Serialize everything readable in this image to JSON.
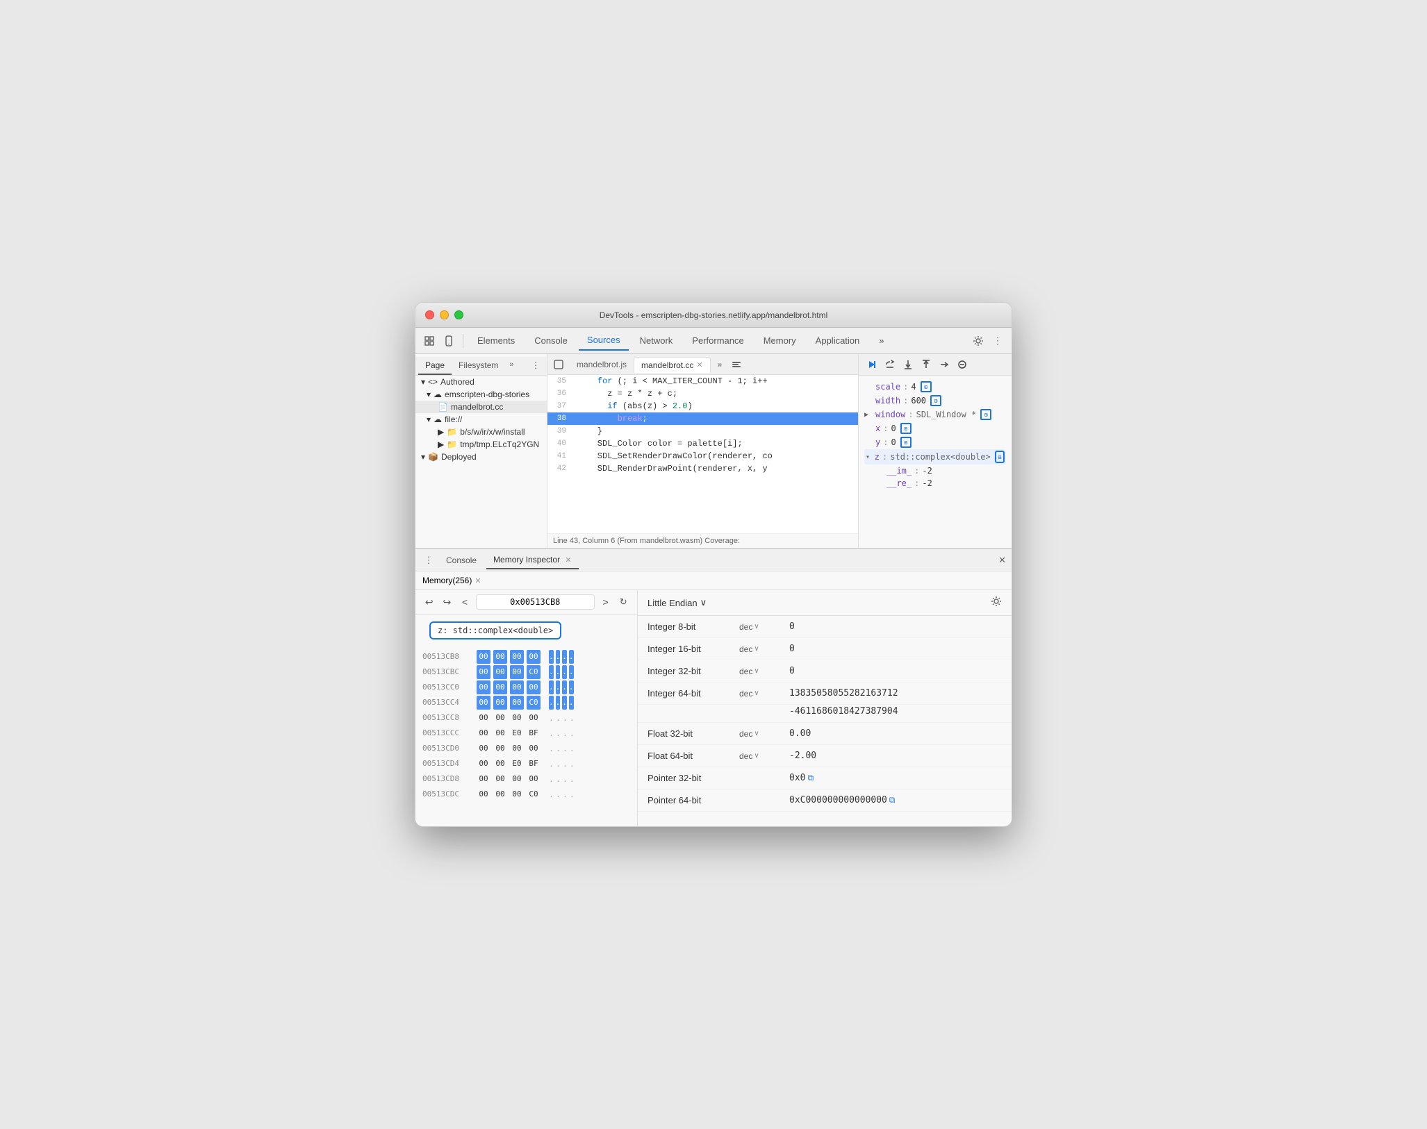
{
  "window": {
    "title": "DevTools - emscripten-dbg-stories.netlify.app/mandelbrot.html"
  },
  "toolbar": {
    "tabs": [
      {
        "label": "Elements",
        "active": false
      },
      {
        "label": "Console",
        "active": false
      },
      {
        "label": "Sources",
        "active": true
      },
      {
        "label": "Network",
        "active": false
      },
      {
        "label": "Performance",
        "active": false
      },
      {
        "label": "Memory",
        "active": false
      },
      {
        "label": "Application",
        "active": false
      }
    ]
  },
  "sources_panel": {
    "left_tabs": [
      {
        "label": "Page",
        "active": true
      },
      {
        "label": "Filesystem",
        "active": false
      }
    ],
    "tree": {
      "authored_label": "▾ <> Authored",
      "emscripten_label": "▾ ☁ emscripten-dbg-stories",
      "mandelbrot_cc": "mandelbrot.cc",
      "file_label": "▾ ☁ file://",
      "bswir_label": "▶ 📁 b/s/w/ir/x/w/install",
      "tmp_label": "▶ 📁 tmp/tmp.ELcTq2YGN",
      "deployed_label": "▾ 📦 Deployed"
    },
    "code_tabs": [
      {
        "label": "mandelbrot.js",
        "active": false,
        "closeable": false
      },
      {
        "label": "mandelbrot.cc",
        "active": true,
        "closeable": true
      }
    ],
    "code_lines": [
      {
        "num": 35,
        "text": "    for (; i < MAX_ITER_COUNT - 1; i++",
        "highlighted": false
      },
      {
        "num": 36,
        "text": "      z = z * z + c;",
        "highlighted": false
      },
      {
        "num": 37,
        "text": "      if (abs(z) > 2.0)",
        "highlighted": false
      },
      {
        "num": 38,
        "text": "        break;",
        "highlighted": true
      },
      {
        "num": 39,
        "text": "    }",
        "highlighted": false
      },
      {
        "num": 40,
        "text": "    SDL_Color color = palette[i];",
        "highlighted": false
      },
      {
        "num": 41,
        "text": "    SDL_SetRenderDrawColor(renderer, co",
        "highlighted": false
      },
      {
        "num": 42,
        "text": "    SDL_RenderDrawPoint(renderer, x, y",
        "highlighted": false
      }
    ],
    "code_footer": "Line 43, Column 6 (From mandelbrot.wasm) Coverage: "
  },
  "debugger": {
    "vars": [
      {
        "name": "scale",
        "value": "4",
        "icon": true,
        "indent": 0
      },
      {
        "name": "width",
        "value": "600",
        "icon": true,
        "indent": 0
      },
      {
        "name": "window",
        "value": "SDL_Window *",
        "icon": true,
        "indent": 0,
        "expandable": true
      },
      {
        "name": "x",
        "value": "0",
        "icon": true,
        "indent": 0
      },
      {
        "name": "y",
        "value": "0",
        "icon": true,
        "indent": 0
      },
      {
        "name": "z",
        "value": "std::complex<double>",
        "icon": true,
        "indent": 0,
        "expandable": true,
        "highlighted": true
      },
      {
        "name": "__im_",
        "value": "-2",
        "indent": 1
      },
      {
        "name": "__re_",
        "value": "-2",
        "indent": 1
      }
    ]
  },
  "bottom_panel": {
    "tabs": [
      {
        "label": "Console",
        "active": false
      },
      {
        "label": "Memory Inspector",
        "active": true,
        "closeable": true
      }
    ],
    "memory_tab": {
      "label": "Memory(256)",
      "closeable": true
    }
  },
  "memory_inspector": {
    "address": "0x00513CB8",
    "expression": "z: std::complex<double>",
    "endian": "Little Endian",
    "rows": [
      {
        "addr": "00513CB8",
        "bytes": [
          "00",
          "00",
          "00",
          "00"
        ],
        "chars": [
          ".",
          ".",
          ".",
          "."
        ],
        "highlighted": true
      },
      {
        "addr": "00513CBC",
        "bytes": [
          "00",
          "00",
          "00",
          "C0"
        ],
        "chars": [
          ".",
          ".",
          ".",
          "."
        ],
        "highlighted": true
      },
      {
        "addr": "00513CC0",
        "bytes": [
          "00",
          "00",
          "00",
          "00"
        ],
        "chars": [
          ".",
          ".",
          ".",
          "."
        ],
        "highlighted": true
      },
      {
        "addr": "00513CC4",
        "bytes": [
          "00",
          "00",
          "00",
          "C0"
        ],
        "chars": [
          ".",
          ".",
          ".",
          "."
        ],
        "highlighted": true
      },
      {
        "addr": "00513CC8",
        "bytes": [
          "00",
          "00",
          "00",
          "00"
        ],
        "chars": [
          ".",
          ".",
          ".",
          "."
        ],
        "highlighted": false
      },
      {
        "addr": "00513CCC",
        "bytes": [
          "00",
          "00",
          "E0",
          "BF"
        ],
        "chars": [
          ".",
          ".",
          ".",
          "."
        ],
        "highlighted": false
      },
      {
        "addr": "00513CD0",
        "bytes": [
          "00",
          "00",
          "00",
          "00"
        ],
        "chars": [
          ".",
          ".",
          ".",
          "."
        ],
        "highlighted": false
      },
      {
        "addr": "00513CD4",
        "bytes": [
          "00",
          "00",
          "E0",
          "BF"
        ],
        "chars": [
          ".",
          ".",
          ".",
          "."
        ],
        "highlighted": false
      },
      {
        "addr": "00513CD8",
        "bytes": [
          "00",
          "00",
          "00",
          "00"
        ],
        "chars": [
          ".",
          ".",
          ".",
          "."
        ],
        "highlighted": false
      },
      {
        "addr": "00513CDC",
        "bytes": [
          "00",
          "00",
          "00",
          "C0"
        ],
        "chars": [
          ".",
          ".",
          ".",
          "."
        ],
        "highlighted": false
      }
    ],
    "values": [
      {
        "type": "Integer 8-bit",
        "format": "dec",
        "value": "0"
      },
      {
        "type": "Integer 16-bit",
        "format": "dec",
        "value": "0"
      },
      {
        "type": "Integer 32-bit",
        "format": "dec",
        "value": "0"
      },
      {
        "type": "Integer 64-bit",
        "format": "dec",
        "value": "13835058055282163712"
      },
      {
        "type": "",
        "format": "",
        "value": "-4611686018427387904"
      },
      {
        "type": "Float 32-bit",
        "format": "dec",
        "value": "0.00"
      },
      {
        "type": "Float 64-bit",
        "format": "dec",
        "value": "-2.00"
      },
      {
        "type": "Pointer 32-bit",
        "format": "",
        "value": "0x0",
        "link": true
      },
      {
        "type": "Pointer 64-bit",
        "format": "",
        "value": "0xC000000000000000",
        "link": true
      }
    ]
  }
}
